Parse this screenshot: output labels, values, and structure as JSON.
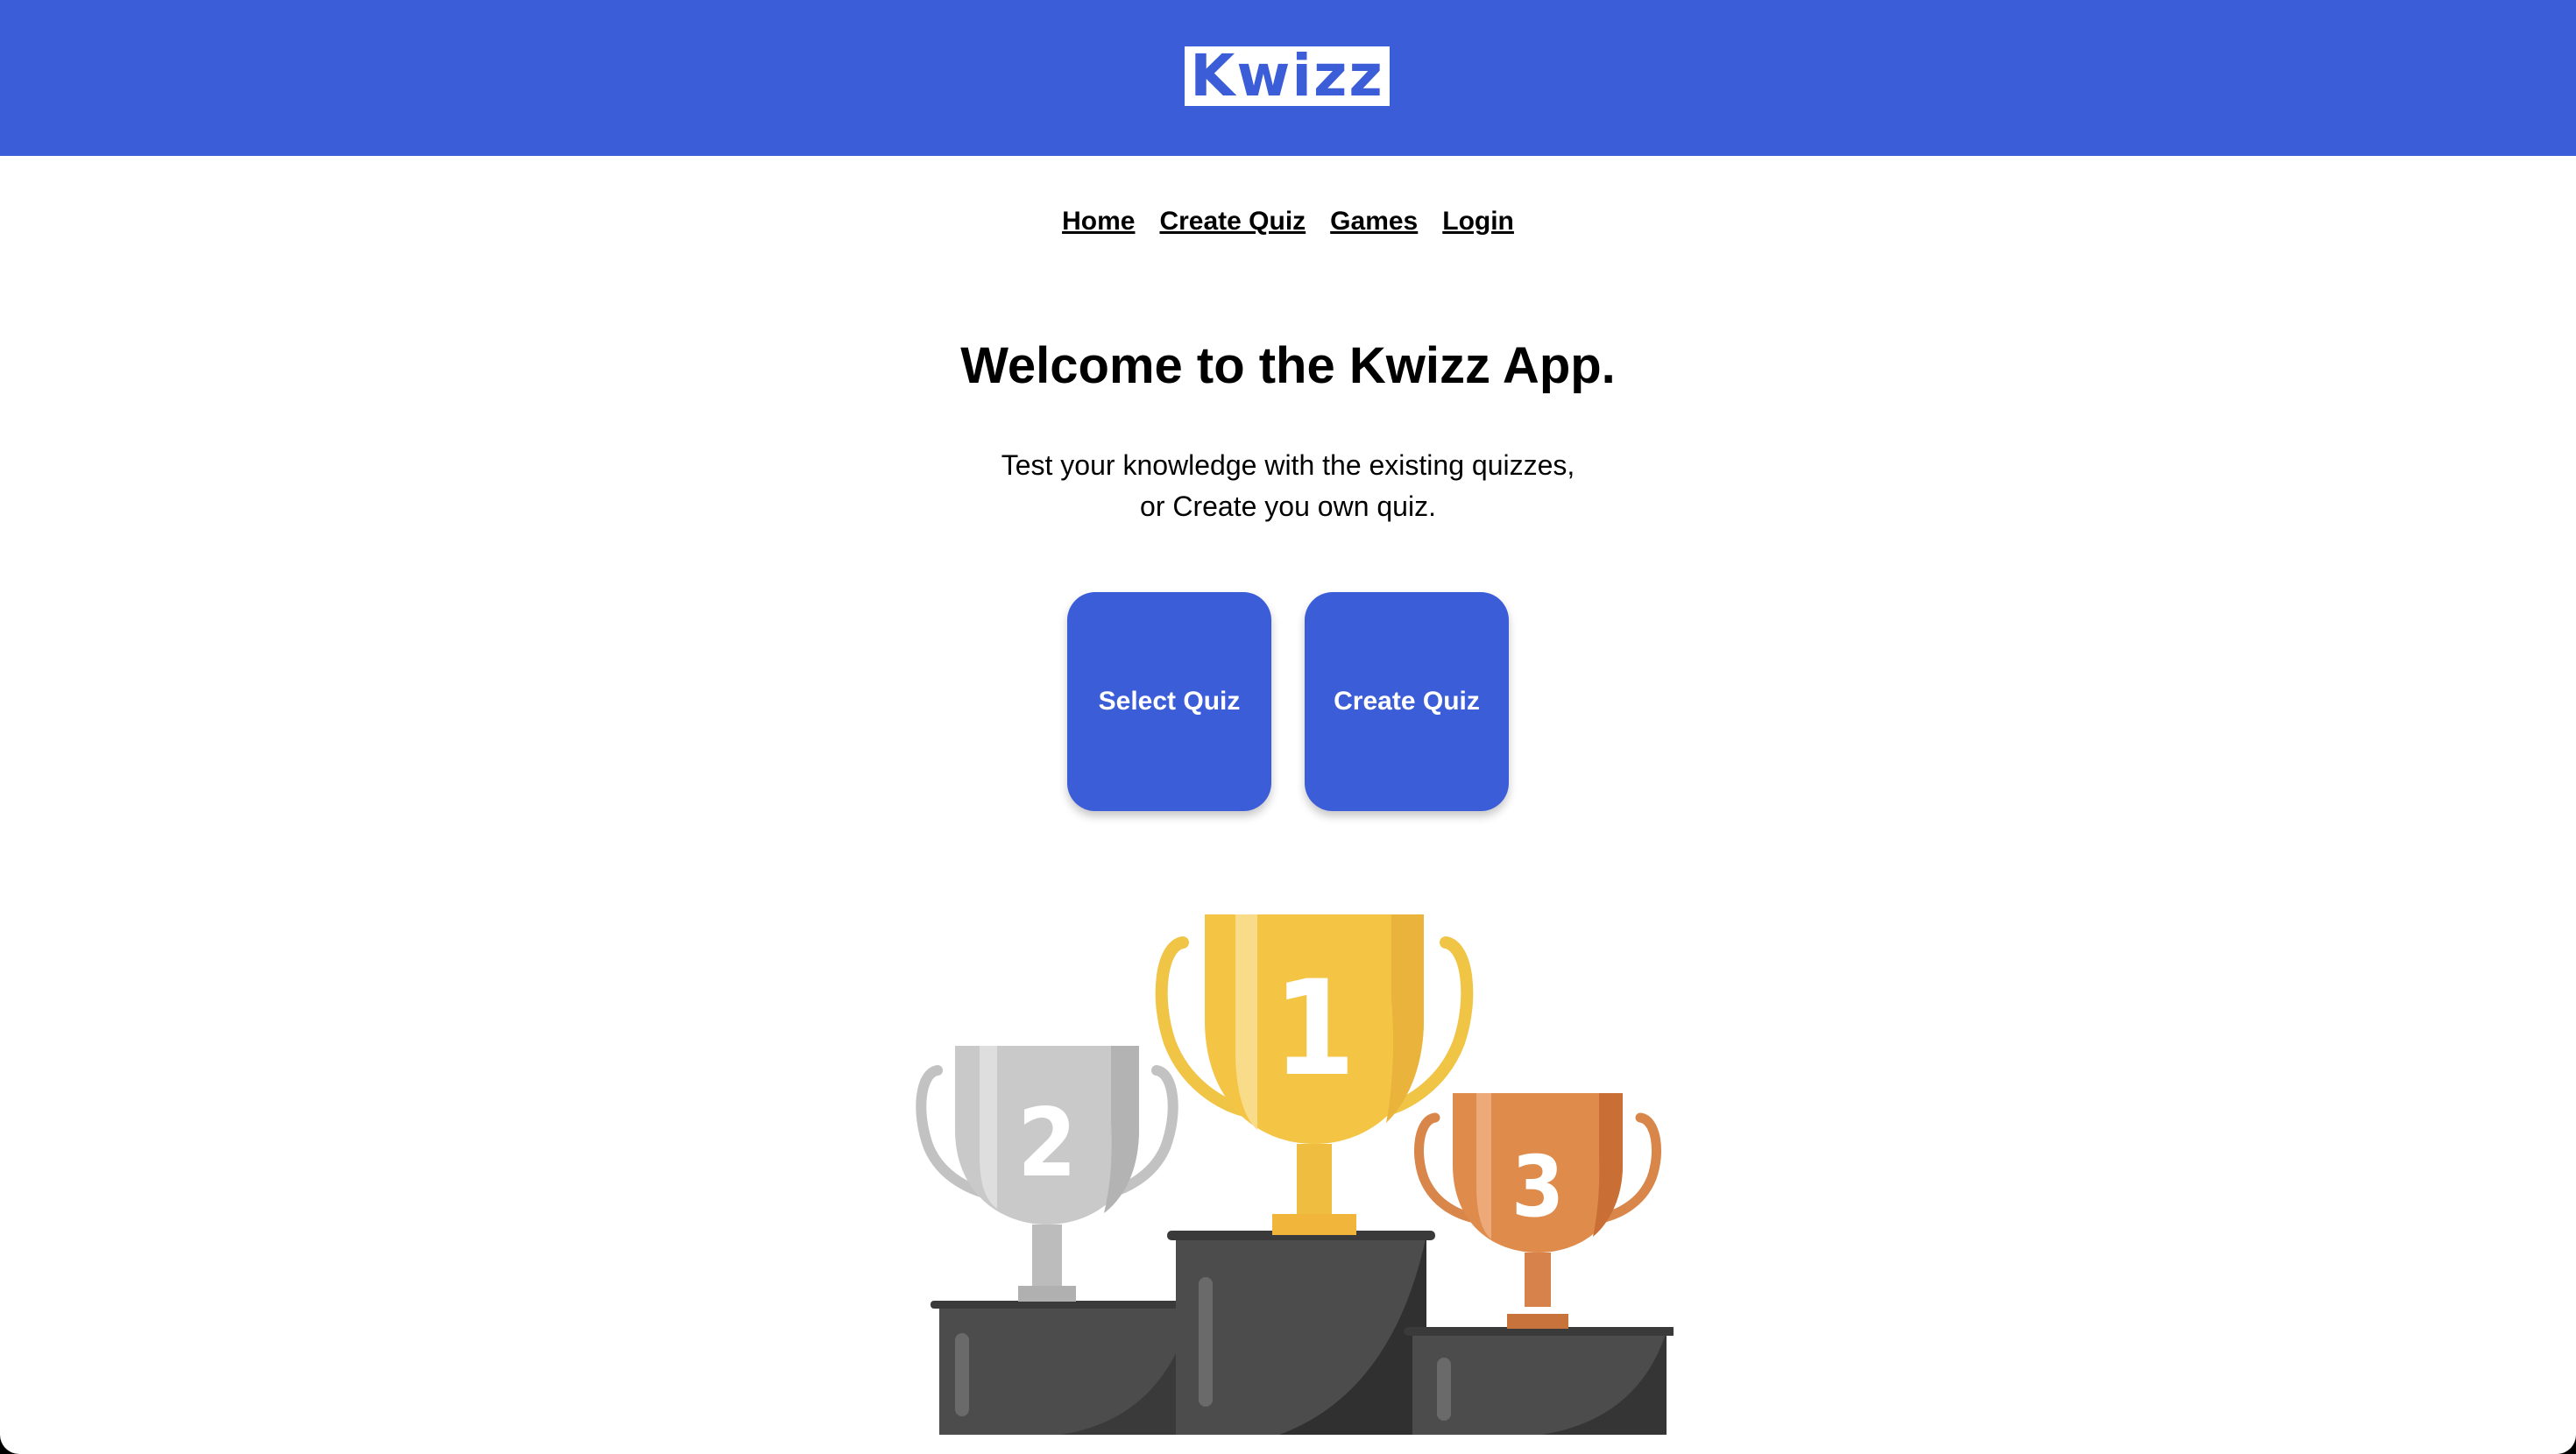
{
  "header": {
    "logo_text": "Kwizz",
    "color": "#3c5dd8"
  },
  "nav": {
    "items": [
      "Home",
      "Create Quiz",
      "Games",
      "Login"
    ]
  },
  "hero": {
    "title": "Welcome to the Kwizz App.",
    "subtitle_line1": "Test your knowledge with the existing quizzes,",
    "subtitle_line2": "or Create you own quiz."
  },
  "actions": {
    "select_quiz": "Select Quiz",
    "create_quiz": "Create Quiz"
  },
  "illustration": {
    "trophies": [
      {
        "place": "1",
        "color": "#f3c545"
      },
      {
        "place": "2",
        "color": "#c9c9c9"
      },
      {
        "place": "3",
        "color": "#dd8a4a"
      }
    ]
  }
}
